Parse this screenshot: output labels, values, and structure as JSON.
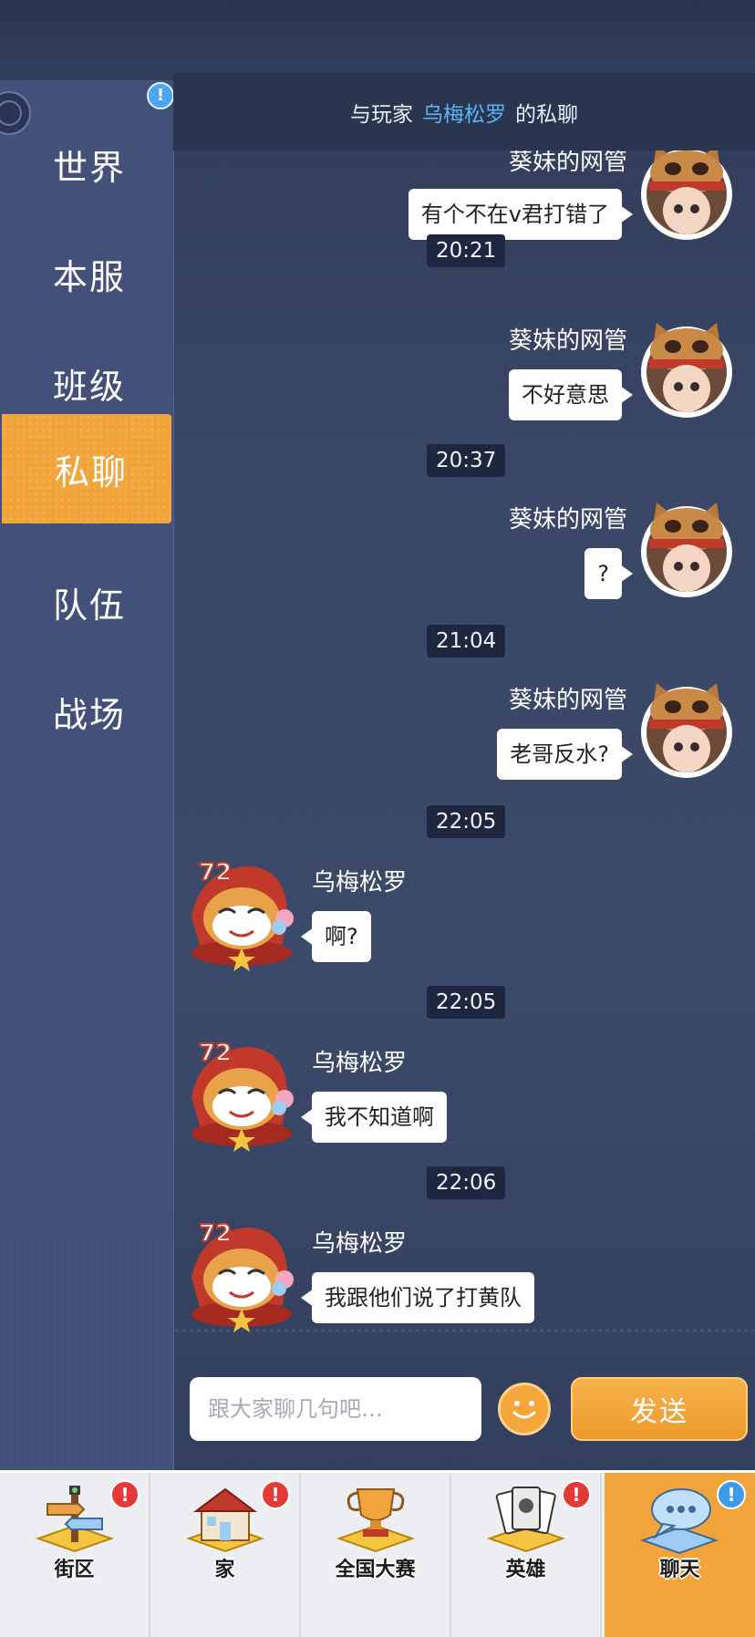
{
  "sidebar": {
    "badge": "!",
    "items": [
      {
        "label": "世界",
        "active": false
      },
      {
        "label": "本服",
        "active": false
      },
      {
        "label": "班级",
        "active": false
      },
      {
        "label": "私聊",
        "active": true
      },
      {
        "label": "队伍",
        "active": false
      },
      {
        "label": "战场",
        "active": false
      }
    ]
  },
  "header": {
    "prefix": "与玩家",
    "player": "乌梅松罗",
    "suffix": "的私聊"
  },
  "messages": [
    {
      "sender": "葵妹的网管",
      "side": "right",
      "text": "有个不在v君打错了"
    },
    {
      "time": "20:21"
    },
    {
      "sender": "葵妹的网管",
      "side": "right",
      "text": "不好意思"
    },
    {
      "time": "20:37"
    },
    {
      "sender": "葵妹的网管",
      "side": "right",
      "text": "?"
    },
    {
      "time": "21:04"
    },
    {
      "sender": "葵妹的网管",
      "side": "right",
      "text": "老哥反水?"
    },
    {
      "time": "22:05"
    },
    {
      "sender": "乌梅松罗",
      "side": "left",
      "text": "啊?",
      "level": "72"
    },
    {
      "time": "22:05"
    },
    {
      "sender": "乌梅松罗",
      "side": "left",
      "text": "我不知道啊",
      "level": "72"
    },
    {
      "time": "22:06"
    },
    {
      "sender": "乌梅松罗",
      "side": "left",
      "text": "我跟他们说了打黄队",
      "level": "72"
    }
  ],
  "input": {
    "placeholder": "跟大家聊几句吧…",
    "send_label": "发送"
  },
  "nav": [
    {
      "label": "街区",
      "badge": "!",
      "badge_color": "red",
      "icon": "signpost-icon"
    },
    {
      "label": "家",
      "badge": "!",
      "badge_color": "red",
      "icon": "house-icon"
    },
    {
      "label": "全国大赛",
      "badge": "",
      "icon": "trophy-icon"
    },
    {
      "label": "英雄",
      "badge": "!",
      "badge_color": "red",
      "icon": "cards-icon"
    },
    {
      "label": "聊天",
      "badge": "!",
      "badge_color": "blue",
      "icon": "chat-bubble-icon",
      "active": true
    }
  ],
  "colors": {
    "accent": "#f0a43a",
    "sidebar": "#43517a",
    "header_name": "#5ab4f5"
  }
}
